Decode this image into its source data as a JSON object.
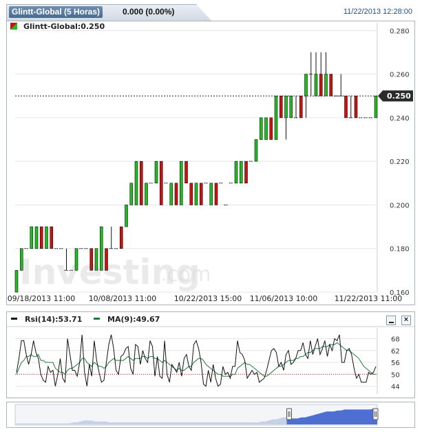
{
  "header": {
    "title": "Glintt-Global (5 Horas)",
    "price_change": "0.000 (0.00%)",
    "datetime": "11/22/2013 12:28:00"
  },
  "legend": {
    "instrument_label": "Glintt-Global:0.250",
    "up_color": "#22bb22",
    "down_color": "#cc1111"
  },
  "watermark": {
    "brand": "Investing",
    "suffix": ".com"
  },
  "chart_data": [
    {
      "type": "candlestick",
      "title": "Glintt-Global (5 Horas)",
      "y_ticks": [
        "0.280",
        "0.260",
        "0.240",
        "0.220",
        "0.200",
        "0.180",
        "0.160"
      ],
      "ylim": [
        0.16,
        0.282
      ],
      "x_ticks": [
        "09/18/2013 11:00",
        "10/08/2013 11:00",
        "10/22/2013 15:00",
        "11/06/2013 10:00",
        "11/22/2013 11:00"
      ],
      "last_price": 0.25,
      "last_price_label": "0.250",
      "grid": true,
      "candles": [
        [
          0.17,
          0.16,
          0.16,
          0.17
        ],
        [
          0.18,
          0.17,
          0.17,
          0.18
        ],
        [
          0.18,
          0.18,
          0.18,
          0.18
        ],
        [
          0.19,
          0.18,
          0.18,
          0.19
        ],
        [
          0.19,
          0.18,
          0.18,
          0.19
        ],
        [
          0.19,
          0.18,
          0.19,
          0.18
        ],
        [
          0.19,
          0.18,
          0.18,
          0.19
        ],
        [
          0.19,
          0.18,
          0.19,
          0.18
        ],
        [
          0.18,
          0.18,
          0.18,
          0.18
        ],
        [
          0.18,
          0.18,
          0.18,
          0.18
        ],
        [
          0.18,
          0.17,
          0.17,
          0.17
        ],
        [
          0.17,
          0.17,
          0.17,
          0.17
        ],
        [
          0.18,
          0.17,
          0.17,
          0.18
        ],
        [
          0.18,
          0.18,
          0.18,
          0.18
        ],
        [
          0.18,
          0.18,
          0.18,
          0.18
        ],
        [
          0.18,
          0.17,
          0.18,
          0.17
        ],
        [
          0.18,
          0.17,
          0.17,
          0.18
        ],
        [
          0.19,
          0.17,
          0.17,
          0.19
        ],
        [
          0.18,
          0.17,
          0.18,
          0.17
        ],
        [
          0.19,
          0.18,
          0.18,
          0.18
        ],
        [
          0.18,
          0.18,
          0.18,
          0.18
        ],
        [
          0.19,
          0.18,
          0.19,
          0.18
        ],
        [
          0.2,
          0.19,
          0.19,
          0.2
        ],
        [
          0.21,
          0.2,
          0.2,
          0.21
        ],
        [
          0.22,
          0.2,
          0.2,
          0.22
        ],
        [
          0.22,
          0.2,
          0.22,
          0.2
        ],
        [
          0.21,
          0.2,
          0.2,
          0.21
        ],
        [
          0.21,
          0.21,
          0.21,
          0.21
        ],
        [
          0.22,
          0.21,
          0.21,
          0.22
        ],
        [
          0.22,
          0.2,
          0.22,
          0.2
        ],
        [
          0.21,
          0.21,
          0.21,
          0.21
        ],
        [
          0.21,
          0.2,
          0.2,
          0.21
        ],
        [
          0.21,
          0.2,
          0.21,
          0.2
        ],
        [
          0.22,
          0.2,
          0.2,
          0.22
        ],
        [
          0.22,
          0.21,
          0.22,
          0.21
        ],
        [
          0.21,
          0.2,
          0.21,
          0.2
        ],
        [
          0.21,
          0.2,
          0.2,
          0.21
        ],
        [
          0.21,
          0.2,
          0.21,
          0.2
        ],
        [
          0.21,
          0.21,
          0.21,
          0.21
        ],
        [
          0.21,
          0.2,
          0.2,
          0.21
        ],
        [
          0.21,
          0.2,
          0.21,
          0.2
        ],
        [
          0.21,
          0.21,
          0.21,
          0.21
        ],
        [
          0.2,
          0.2,
          0.2,
          0.2
        ],
        [
          0.21,
          0.21,
          0.21,
          0.21
        ],
        [
          0.22,
          0.21,
          0.21,
          0.22
        ],
        [
          0.22,
          0.21,
          0.21,
          0.22
        ],
        [
          0.22,
          0.21,
          0.22,
          0.21
        ],
        [
          0.22,
          0.22,
          0.22,
          0.22
        ],
        [
          0.23,
          0.22,
          0.22,
          0.23
        ],
        [
          0.24,
          0.23,
          0.23,
          0.24
        ],
        [
          0.24,
          0.23,
          0.23,
          0.24
        ],
        [
          0.24,
          0.23,
          0.24,
          0.23
        ],
        [
          0.25,
          0.23,
          0.23,
          0.25
        ],
        [
          0.25,
          0.24,
          0.25,
          0.24
        ],
        [
          0.25,
          0.23,
          0.24,
          0.25
        ],
        [
          0.25,
          0.24,
          0.24,
          0.25
        ],
        [
          0.25,
          0.24,
          0.24,
          0.24
        ],
        [
          0.25,
          0.24,
          0.25,
          0.24
        ],
        [
          0.26,
          0.24,
          0.25,
          0.26
        ],
        [
          0.27,
          0.25,
          0.26,
          0.26
        ],
        [
          0.27,
          0.25,
          0.25,
          0.26
        ],
        [
          0.27,
          0.25,
          0.26,
          0.25
        ],
        [
          0.27,
          0.25,
          0.25,
          0.26
        ],
        [
          0.26,
          0.25,
          0.26,
          0.25
        ],
        [
          0.25,
          0.25,
          0.25,
          0.25
        ],
        [
          0.26,
          0.25,
          0.25,
          0.25
        ],
        [
          0.25,
          0.24,
          0.25,
          0.24
        ],
        [
          0.25,
          0.24,
          0.24,
          0.24
        ],
        [
          0.25,
          0.24,
          0.25,
          0.24
        ],
        [
          0.24,
          0.24,
          0.24,
          0.24
        ],
        [
          0.24,
          0.24,
          0.24,
          0.24
        ],
        [
          0.24,
          0.24,
          0.24,
          0.24
        ],
        [
          0.25,
          0.24,
          0.24,
          0.25
        ]
      ]
    },
    {
      "type": "line",
      "series": [
        {
          "name": "Rsi(14)",
          "last_label": "Rsi(14):53.71",
          "color": "#111111",
          "values": [
            51,
            58,
            67,
            67,
            60,
            55,
            60,
            67,
            61,
            58,
            50,
            47,
            46,
            54,
            51,
            52,
            44,
            50,
            58,
            48,
            46,
            68,
            60,
            52,
            52,
            49,
            56,
            70,
            51,
            44,
            55,
            49,
            67,
            57,
            51,
            46,
            47,
            56,
            65,
            70,
            63,
            52,
            50,
            59,
            60,
            63,
            64,
            53,
            50,
            65,
            64,
            55,
            62,
            58,
            56,
            67,
            64,
            49,
            59,
            49,
            48,
            67,
            50,
            46,
            55,
            53,
            51,
            56,
            49,
            58,
            60,
            54,
            52,
            65,
            67,
            63,
            56,
            45,
            44,
            52,
            46,
            55,
            48,
            44,
            45,
            54,
            50,
            51,
            48,
            54,
            54,
            67,
            61,
            60,
            57,
            48,
            50,
            52,
            50,
            51,
            46,
            47,
            48,
            52,
            57,
            62,
            63,
            61,
            54,
            56,
            52,
            60,
            62,
            55,
            56,
            58,
            62,
            62,
            66,
            60,
            58,
            67,
            60,
            64,
            68,
            60,
            63,
            67,
            59,
            65,
            62,
            68,
            67,
            70,
            56,
            56,
            62,
            63,
            60,
            53,
            48,
            50,
            46,
            46,
            46,
            51,
            50,
            51,
            54
          ]
        },
        {
          "name": "MA(9)",
          "last_label": "MA(9):49.67",
          "color": "#1f7a3a",
          "values": [
            50,
            53,
            56,
            57,
            59,
            59,
            60,
            59,
            59,
            60,
            57,
            57,
            56,
            56,
            56,
            56,
            53,
            52,
            51,
            51,
            50,
            52,
            53,
            53,
            54,
            55,
            56,
            58,
            58,
            56,
            55,
            54,
            56,
            55,
            54,
            54,
            53,
            54,
            56,
            57,
            58,
            57,
            57,
            57,
            57,
            58,
            59,
            58,
            57,
            58,
            58,
            58,
            59,
            59,
            58,
            59,
            59,
            58,
            58,
            57,
            56,
            57,
            56,
            55,
            54,
            53,
            52,
            53,
            52,
            52,
            53,
            54,
            54,
            56,
            57,
            58,
            58,
            57,
            55,
            54,
            53,
            52,
            51,
            50,
            50,
            49,
            49,
            49,
            49,
            50,
            50,
            53,
            54,
            55,
            56,
            55,
            55,
            54,
            53,
            52,
            51,
            50,
            49,
            49,
            50,
            51,
            52,
            53,
            54,
            54,
            55,
            56,
            57,
            57,
            57,
            58,
            58,
            59,
            59,
            60,
            61,
            61,
            62,
            63,
            63,
            63,
            64,
            64,
            64,
            65,
            65,
            65,
            66,
            65,
            64,
            63,
            62,
            62,
            61,
            60,
            59,
            58,
            56,
            54,
            53,
            52,
            51,
            50,
            50
          ]
        }
      ],
      "y_ticks": [
        "68",
        "62",
        "56",
        "50",
        "44"
      ],
      "ylim": [
        40,
        72
      ],
      "reference_level": 50
    }
  ],
  "navigator": {
    "values": [
      1,
      1,
      1,
      1,
      1,
      1,
      1,
      1,
      1,
      1,
      1,
      1,
      1,
      1,
      1,
      1,
      2,
      2,
      3,
      4,
      4,
      4,
      3,
      3,
      3,
      3,
      2,
      2,
      2,
      2,
      2,
      2,
      2,
      2,
      2,
      2,
      2,
      2,
      2,
      2,
      2,
      2,
      2,
      2,
      2,
      2,
      2,
      2,
      2,
      2,
      2,
      2,
      2,
      2,
      2,
      2,
      2,
      2,
      2,
      2,
      2,
      2,
      2,
      2,
      2,
      2,
      2,
      2,
      3,
      3,
      4,
      5,
      5,
      6,
      7,
      7,
      6,
      6,
      6,
      7,
      7,
      8,
      9,
      10,
      11,
      12,
      13,
      13,
      13,
      14,
      14,
      15,
      15,
      15,
      15,
      15,
      15,
      15,
      15,
      16,
      16
    ],
    "window_start": 0.75,
    "window_end": 1.0,
    "fill_color": "#c6d0e6",
    "window_fill_color": "#4c6fd1"
  }
}
